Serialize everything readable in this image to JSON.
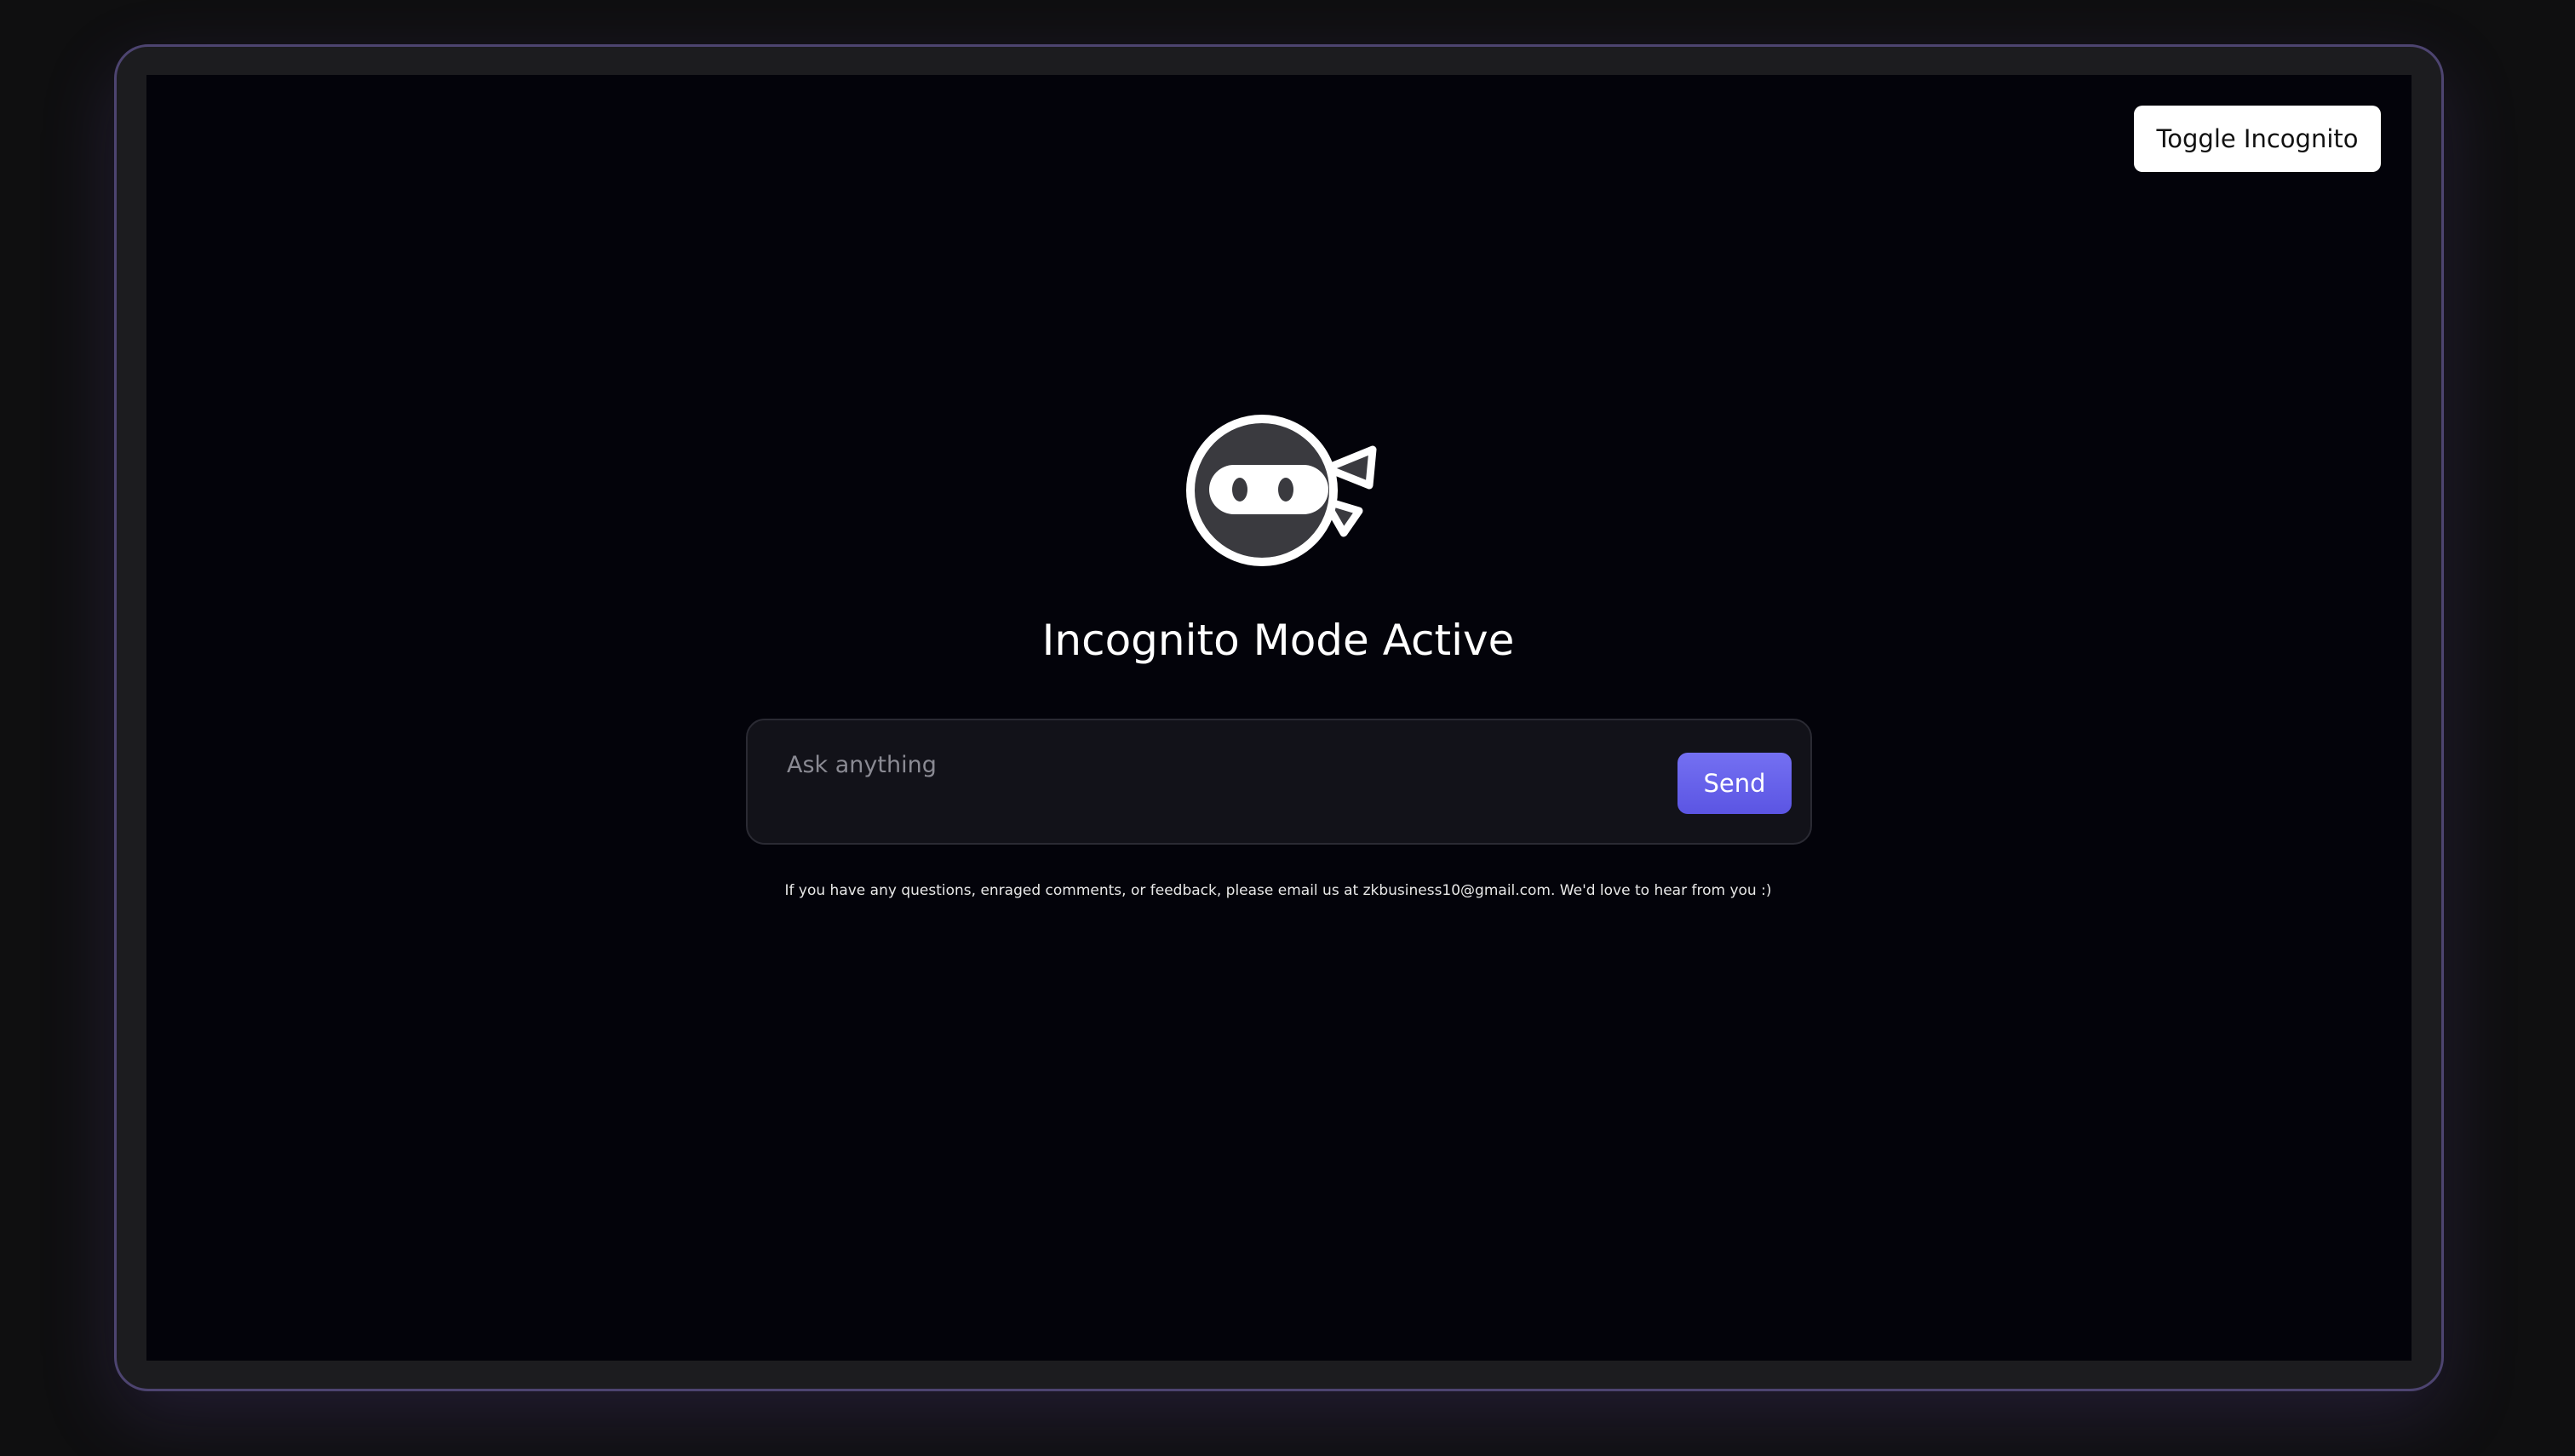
{
  "header": {
    "toggle_label": "Toggle Incognito"
  },
  "main": {
    "logo_icon": "ninja-icon",
    "title": "Incognito Mode Active",
    "input": {
      "value": "",
      "placeholder": "Ask anything"
    },
    "send_label": "Send",
    "footer_note": "If you have any questions, enraged comments, or feedback, please email us at zkbusiness10@gmail.com. We'd love to hear from you :)"
  },
  "colors": {
    "background": "#03030a",
    "frame_border": "#4d4470",
    "accent": "#6a65ef",
    "input_bg": "#121219"
  }
}
